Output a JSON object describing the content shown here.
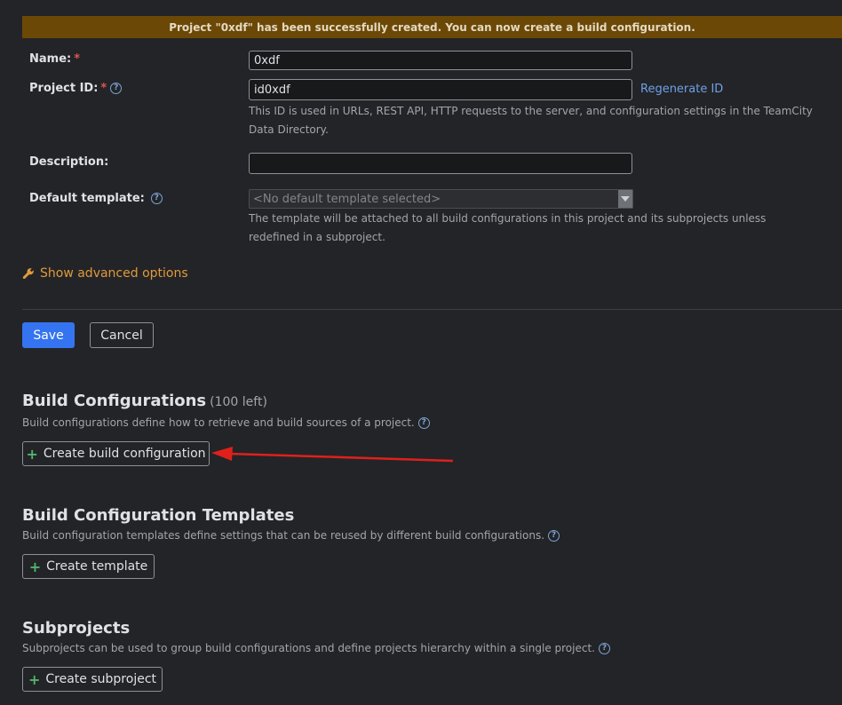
{
  "banner": {
    "message": "Project \"0xdf\" has been successfully created. You can now create a build configuration."
  },
  "form": {
    "name_label": "Name:",
    "required_mark": "*",
    "name_value": "0xdf",
    "project_id_label": "Project ID:",
    "project_id_value": "id0xdf",
    "regenerate_label": "Regenerate ID",
    "project_id_note": "This ID is used in URLs, REST API, HTTP requests to the server, and configuration settings in the TeamCity Data Directory.",
    "description_label": "Description:",
    "description_value": "",
    "default_template_label": "Default template:",
    "default_template_value": "<No default template selected>",
    "default_template_note": "The template will be attached to all build configurations in this project and its subprojects unless redefined in a subproject.",
    "help_glyph": "?",
    "advanced_label": "Show advanced options",
    "save_label": "Save",
    "cancel_label": "Cancel"
  },
  "sections": {
    "build_configs": {
      "title": "Build Configurations",
      "count": "(100 left)",
      "description": "Build configurations define how to retrieve and build sources of a project.",
      "button": "Create build configuration"
    },
    "templates": {
      "title": "Build Configuration Templates",
      "description": "Build configuration templates define settings that can be reused by different build configurations.",
      "button": "Create template"
    },
    "subprojects": {
      "title": "Subprojects",
      "description": "Subprojects can be used to group build configurations and define projects hierarchy within a single project.",
      "button": "Create subproject"
    }
  },
  "colors": {
    "background": "#232427",
    "banner": "#6b4806",
    "accent": "#3574f0",
    "link": "#6fa0e6",
    "advanced": "#e09a3c",
    "plus": "#4fb56b",
    "annotation_arrow": "#e0201b"
  },
  "icons": {
    "help": "help-circle-icon",
    "wrench": "wrench-icon",
    "plus": "plus-icon",
    "dropdown": "chevron-down-icon"
  }
}
